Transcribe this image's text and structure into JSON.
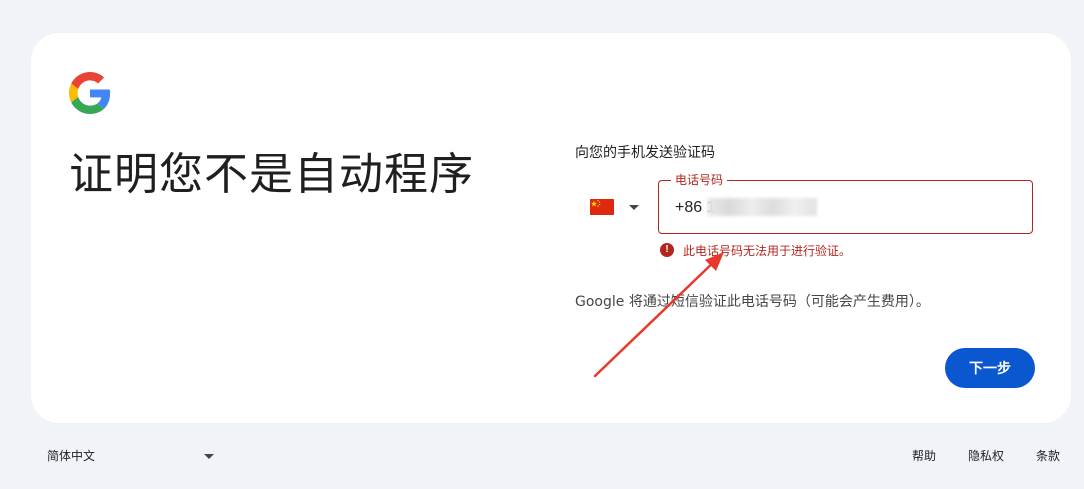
{
  "headline": "证明您不是自动程序",
  "form": {
    "send_label": "向您的手机发送验证码",
    "country": {
      "flag": "china-flag",
      "selected": "China"
    },
    "phone": {
      "label": "电话号码",
      "value": "+86 1"
    },
    "error": {
      "icon": "error-icon",
      "icon_glyph": "!",
      "message": "此电话号码无法用于进行验证。"
    },
    "sms_note": "Google 将通过短信验证此电话号码（可能会产生费用）。",
    "next_label": "下一步"
  },
  "footer": {
    "language": "简体中文",
    "links": {
      "help": "帮助",
      "privacy": "隐私权",
      "terms": "条款"
    }
  },
  "colors": {
    "background": "#f0f4f9",
    "card": "#ffffff",
    "error": "#b3261e",
    "primary": "#0b57d0",
    "annotation_arrow": "#e8392b"
  }
}
